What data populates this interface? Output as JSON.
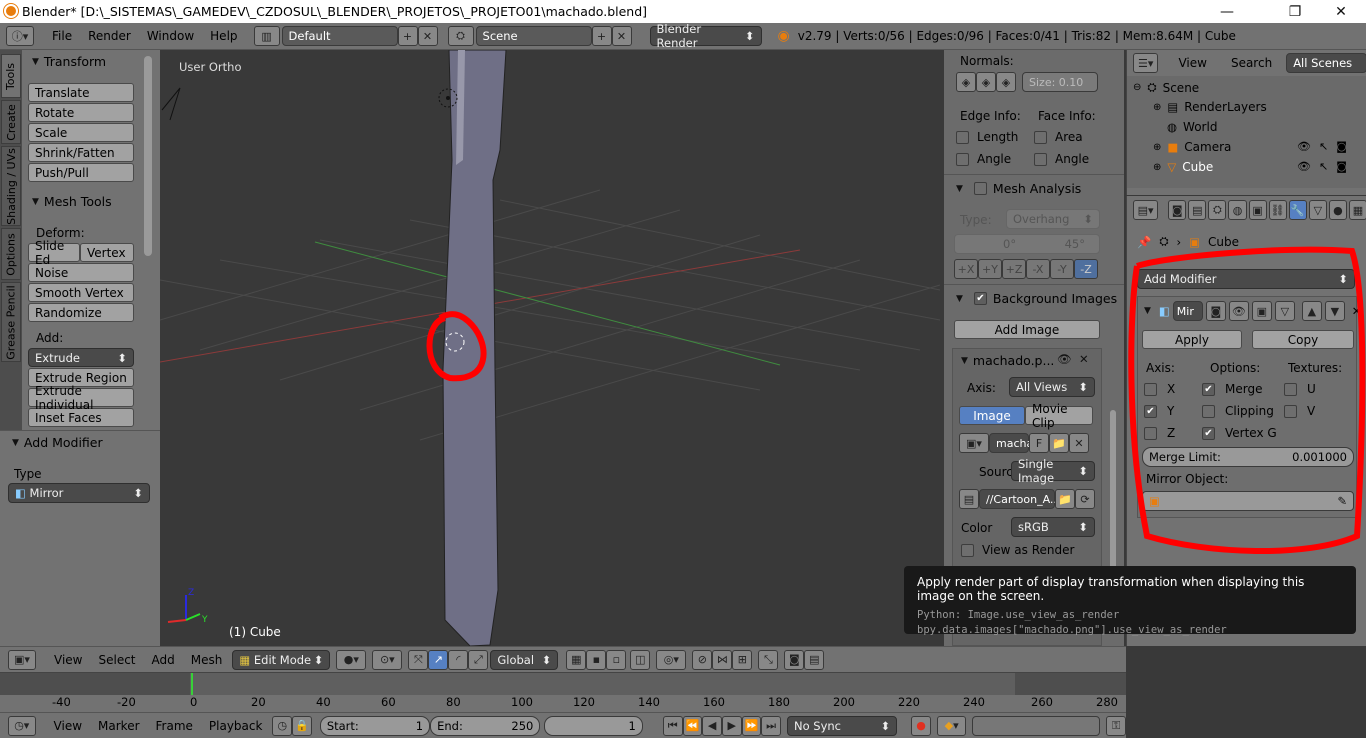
{
  "window": {
    "title": "Blender* [D:\\_SISTEMAS\\_GAMEDEV\\_CZDOSUL\\_BLENDER\\_PROJETOS\\_PROJETO01\\machado.blend]",
    "min": "—",
    "max": "❐",
    "close": "✕"
  },
  "info": {
    "menus": [
      "File",
      "Render",
      "Window",
      "Help"
    ],
    "layout": "Default",
    "scene": "Scene",
    "engine": "Blender Render",
    "stats": "v2.79 | Verts:0/56 | Edges:0/96 | Faces:0/41 | Tris:82 | Mem:8.64M | Cube"
  },
  "tools": {
    "tabs": [
      "Tools",
      "Create",
      "Shading / UVs",
      "Options",
      "Grease Pencil"
    ],
    "transform_header": "Transform",
    "transform": [
      "Translate",
      "Rotate",
      "Scale",
      "Shrink/Fatten",
      "Push/Pull"
    ],
    "mesh_tools_header": "Mesh Tools",
    "deform_label": "Deform:",
    "slide_edge": "Slide Ed",
    "vertex": "Vertex",
    "deform": [
      "Noise",
      "Smooth Vertex",
      "Randomize"
    ],
    "add_label": "Add:",
    "extrude": "Extrude",
    "add": [
      "Extrude Region",
      "Extrude Individual",
      "Inset Faces"
    ]
  },
  "operator": {
    "header": "Add Modifier",
    "type_label": "Type",
    "type_value": "Mirror"
  },
  "viewport": {
    "view_name": "User Ortho",
    "object_label": "(1) Cube"
  },
  "props": {
    "normals_label": "Normals:",
    "size": "Size:  0.10",
    "edge_info": "Edge Info:",
    "face_info": "Face Info:",
    "length": "Length",
    "area": "Area",
    "angle1": "Angle",
    "angle2": "Angle",
    "mesh_analysis": "Mesh Analysis",
    "type_label": "Type:",
    "type_value": "Overhang",
    "deg0": "0°",
    "deg45": "45°",
    "axes": [
      "+X",
      "+Y",
      "+Z",
      "-X",
      "-Y",
      "-Z"
    ],
    "bg_images": "Background Images",
    "add_image": "Add Image",
    "image_name": "machado.p...",
    "axis_label": "Axis:",
    "axis_value": "All Views",
    "image_tab": "Image",
    "movie_tab": "Movie Clip",
    "img_field": "macha",
    "img_f": "F",
    "source_label": "Source",
    "source_value": "Single Image",
    "filepath": "//Cartoon_A...",
    "color_label": "Color",
    "color_value": "sRGB",
    "view_as_render": "View as Render"
  },
  "outliner": {
    "view": "View",
    "search": "Search",
    "filter": "All Scenes",
    "items": [
      "Scene",
      "RenderLayers",
      "World",
      "Camera",
      "Cube"
    ]
  },
  "modifier": {
    "object": "Cube",
    "add_modifier": "Add Modifier",
    "mod_name": "Mir",
    "apply": "Apply",
    "copy": "Copy",
    "axis": "Axis:",
    "options": "Options:",
    "textures": "Textures:",
    "x": "X",
    "y": "Y",
    "z": "Z",
    "merge": "Merge",
    "clipping": "Clipping",
    "vertex_g": "Vertex G",
    "u": "U",
    "v": "V",
    "merge_limit_label": "Merge Limit:",
    "merge_limit_value": "0.001000",
    "mirror_object": "Mirror Object:"
  },
  "tooltip": {
    "text": "Apply render part of display transformation when displaying this image on the screen.",
    "py1": "Python: Image.use_view_as_render",
    "py2": "bpy.data.images[\"machado.png\"].use_view_as_render"
  },
  "view3d_header": {
    "menus": [
      "View",
      "Select",
      "Add",
      "Mesh"
    ],
    "mode": "Edit Mode",
    "orientation": "Global"
  },
  "timeline": {
    "ticks": [
      "-40",
      "-20",
      "0",
      "20",
      "40",
      "60",
      "80",
      "100",
      "120",
      "140",
      "160",
      "180",
      "200",
      "220",
      "240",
      "260",
      "280"
    ],
    "menus": [
      "View",
      "Marker",
      "Frame",
      "Playback"
    ],
    "start_label": "Start:",
    "start": "1",
    "end_label": "End:",
    "end": "250",
    "current": "1",
    "sync": "No Sync"
  },
  "colors": {
    "accent": "#5680c2",
    "annotation": "#ff0000",
    "tooltip_bg": "#191919"
  }
}
